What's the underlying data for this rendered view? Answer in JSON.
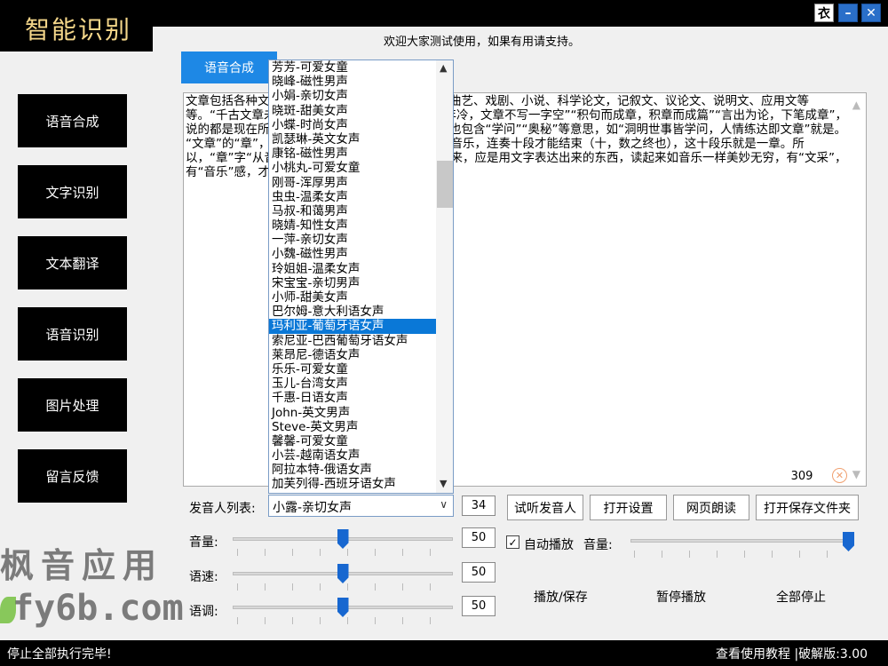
{
  "app": {
    "title": "智能识别",
    "welcome": "欢迎大家测试使用，如果有用请支持。",
    "window_buttons": [
      "衣",
      "–",
      "✕"
    ]
  },
  "sidebar": {
    "items": [
      {
        "label": "语音合成"
      },
      {
        "label": "文字识别"
      },
      {
        "label": "文本翻译"
      },
      {
        "label": "语音识别"
      },
      {
        "label": "图片处理"
      },
      {
        "label": "留言反馈"
      }
    ]
  },
  "tabs": {
    "active": "语音合成"
  },
  "editor": {
    "text": "文章包括各种文体，如诗歌、散文、小说、剧本、曲艺、戏剧、小说、科学论文，记叙文、议论文、说明文、应用文等等。“千古文章未尽才”“文章千古事”“板凳要坐十年冷，文章不写一字空”“积句而成章，积章而成篇”“言出为论，下笔成章”，说的都是现在所说的文章的意思。更广义的文章，也包含“学问”“奥秘”等意思，如“洞明世事皆学问，人情练达即文章”就是。\n“文章”的“章”，本意就是一个“音乐”单元，古代奏音乐，连奏十段才能结束（十，数之终也），这十段乐就是一章。所以，“章”字“从音从十”。那么，从“音乐”里会意出来，应是用文字表达出来的东西，读起来如音乐一样美妙无穷，有“文采”，有“音乐”感，才配得上“文章”一词的真正含义。",
    "char_count": "309"
  },
  "voice_list": {
    "items": [
      "芳芳-可爱女童",
      "晓峰-磁性男声",
      "小娟-亲切女声",
      "晓斑-甜美女声",
      "小蝶-时尚女声",
      "凯瑟琳-英文女声",
      "康铭-磁性男声",
      "小桃丸-可爱女童",
      "刚哥-浑厚男声",
      "虫虫-温柔女声",
      "马叔-和蔼男声",
      "晓婧-知性女声",
      "一萍-亲切女声",
      "小魏-磁性男声",
      "玲姐姐-温柔女声",
      "宋宝宝-亲切男声",
      "小师-甜美女声",
      "巴尔姆-意大利语女声",
      "玛利亚-葡萄牙语女声",
      "索尼亚-巴西葡萄牙语女声",
      "莱昂尼-德语女声",
      "乐乐-可爱女童",
      "玉儿-台湾女声",
      "千惠-日语女声",
      "John-英文男声",
      "Steve-英文男声",
      "馨馨-可爱女童",
      "小芸-越南语女声",
      "阿拉本特-俄语女声",
      "加芙列得-西班牙语女声"
    ],
    "selected_index": 18
  },
  "controls": {
    "speaker_label": "发音人列表:",
    "speaker_selected": "小露-亲切女声",
    "speaker_count": "34",
    "buttons": {
      "preview": "试听发音人",
      "settings": "打开设置",
      "web_read": "网页朗读",
      "open_folder": "打开保存文件夹"
    },
    "volume_label": "音量:",
    "volume_value": "50",
    "volume_level": 0.5,
    "speed_label": "语速:",
    "speed_value": "50",
    "speed_level": 0.5,
    "pitch_label": "语调:",
    "pitch_value": "50",
    "pitch_level": 0.5,
    "auto_play_label": "自动播放",
    "auto_play_checked": true,
    "play_volume_label": "音量:",
    "play_volume_level": 1.0,
    "play_save": "播放/保存",
    "pause": "暂停播放",
    "stop_all": "全部停止"
  },
  "watermark": {
    "line1": "枫音应用",
    "line2": "fy6b.com"
  },
  "status": {
    "left": "停止全部执行完毕!",
    "right": "查看使用教程 |破解版:3.00"
  }
}
